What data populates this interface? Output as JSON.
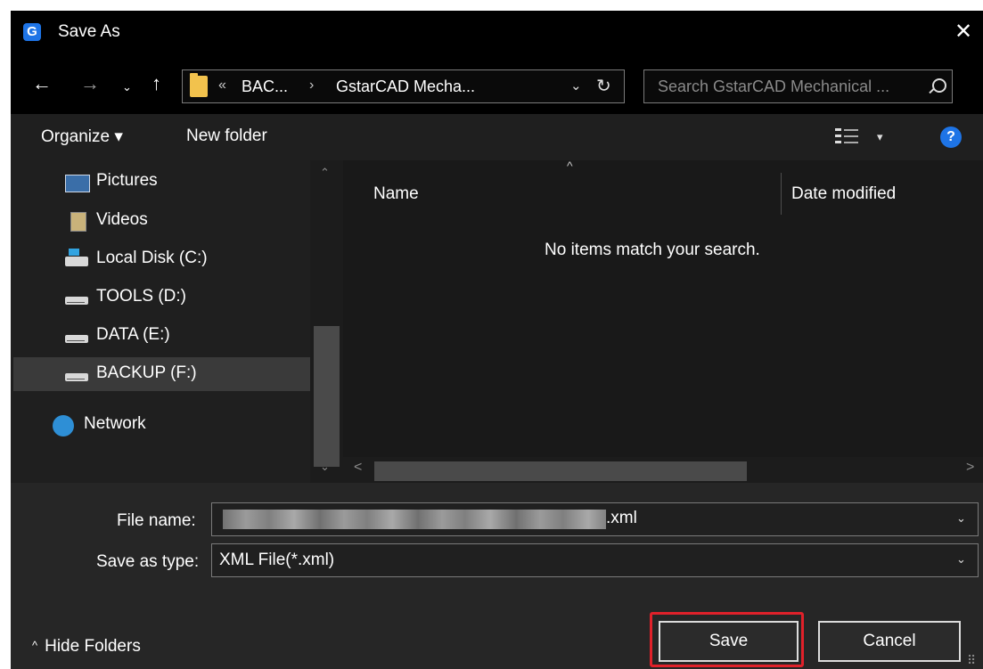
{
  "dialog": {
    "title": "Save As",
    "app_icon": "G",
    "close_glyph": "✕"
  },
  "nav": {
    "back": "←",
    "forward": "→",
    "recent": "⌄",
    "up": "↑"
  },
  "address": {
    "sep0": "«",
    "crumb1": "BAC...",
    "sep": "›",
    "crumb2": "GstarCAD Mecha...",
    "dropdown": "⌄",
    "refresh": "↻"
  },
  "search": {
    "placeholder": "Search GstarCAD Mechanical ..."
  },
  "toolbar": {
    "organize": "Organize ▾",
    "new_folder": "New folder",
    "view_dropdown": "▾",
    "help": "?"
  },
  "sidebar": {
    "items": [
      {
        "label": "Pictures"
      },
      {
        "label": "Videos"
      },
      {
        "label": "Local Disk (C:)"
      },
      {
        "label": "TOOLS (D:)"
      },
      {
        "label": "DATA (E:)"
      },
      {
        "label": "BACKUP (F:)",
        "selected": true
      },
      {
        "label": "Network"
      }
    ],
    "scroll_up": "⌃",
    "scroll_down": "⌄"
  },
  "files": {
    "sort_indicator": "^",
    "columns": [
      "Name",
      "Date modified"
    ],
    "empty_message": "No items match your search.",
    "scroll_left": "<",
    "scroll_right": ">"
  },
  "form": {
    "file_name_label": "File name:",
    "file_name_ext": ".xml",
    "type_label": "Save as type:",
    "type_value": "XML File(*.xml)",
    "dropdown_glyph": "⌄"
  },
  "footer": {
    "hide_folders": "Hide Folders",
    "caret": "^",
    "grip": "⠿"
  },
  "buttons": {
    "save": "Save",
    "cancel": "Cancel"
  },
  "colors": {
    "accent": "#1e74e6",
    "highlight": "#e0212a",
    "folder": "#f2c24d"
  }
}
